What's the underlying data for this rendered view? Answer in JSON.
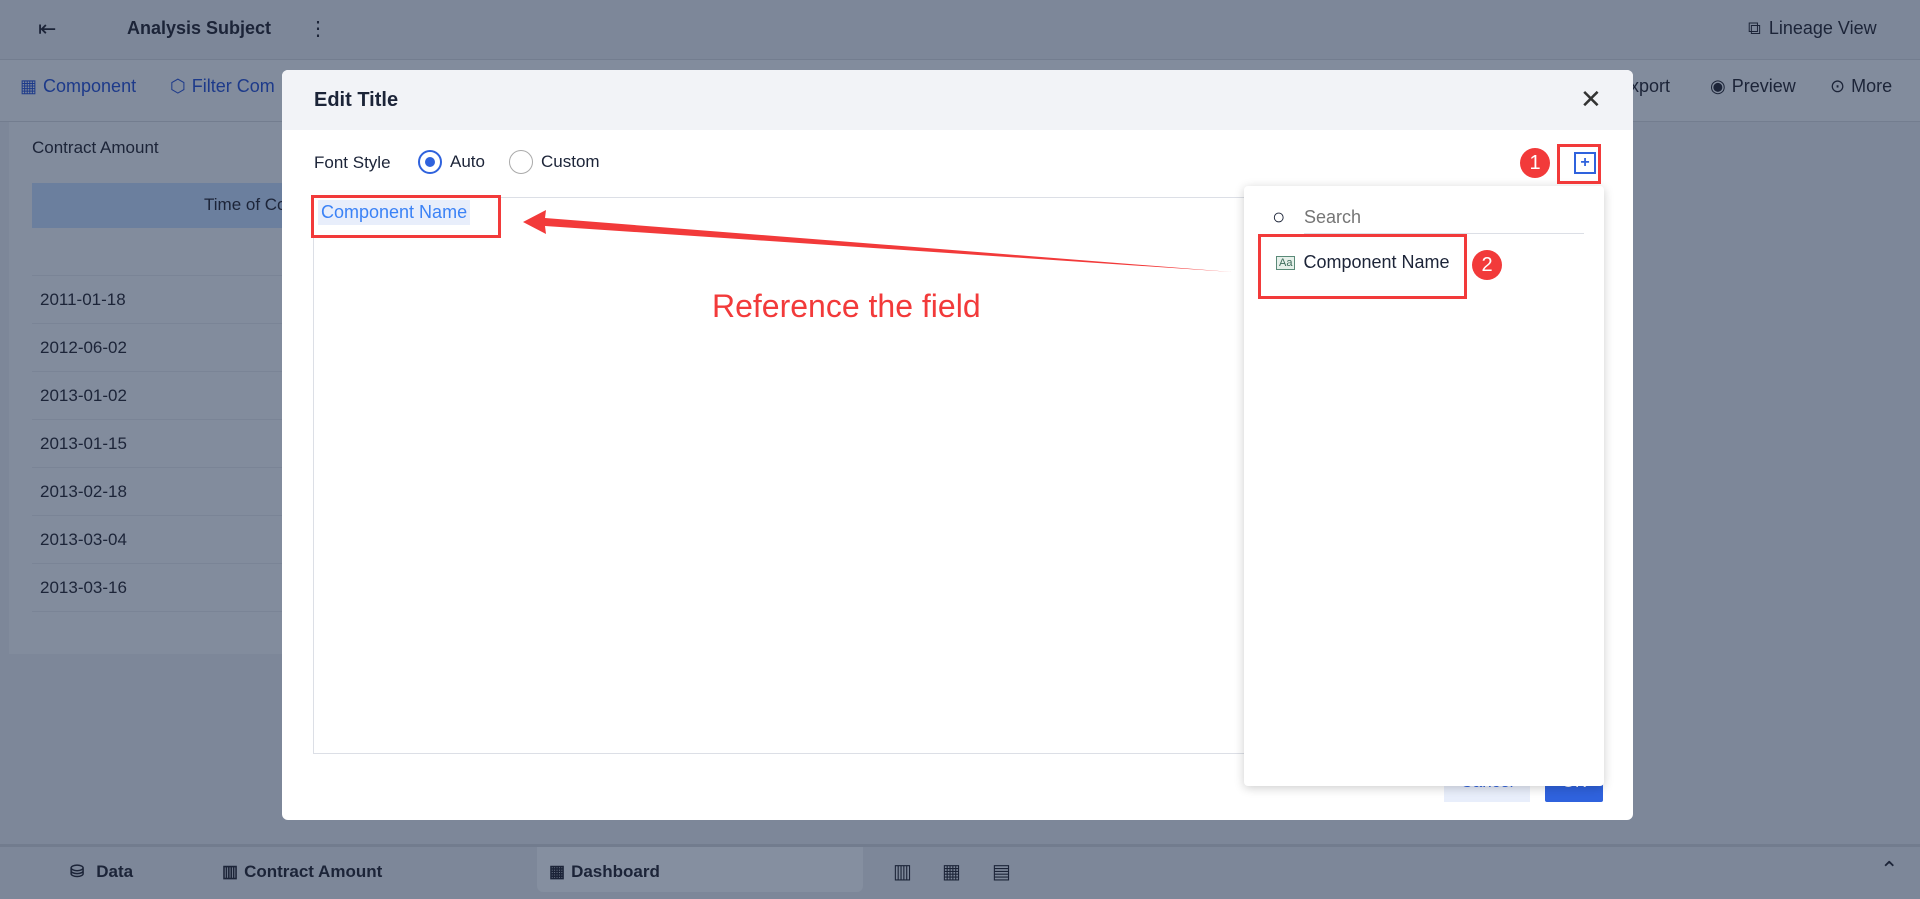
{
  "topbar": {
    "title": "Analysis Subject",
    "lineage": "Lineage View"
  },
  "toolbar": {
    "component": "Component",
    "filter": "Filter Com",
    "export": "xport",
    "preview": "Preview",
    "more": "More"
  },
  "card": {
    "title": "Contract Amount",
    "column_header": "Time of Co",
    "rows": [
      "2011-01-18",
      "2012-06-02",
      "2013-01-02",
      "2013-01-15",
      "2013-02-18",
      "2013-03-04",
      "2013-03-16"
    ]
  },
  "modal": {
    "title": "Edit Title",
    "font_style_label": "Font Style",
    "options": [
      "Auto",
      "Custom"
    ],
    "selected": "Auto",
    "editor_token": "Component Name",
    "cancel": "Cancel",
    "ok": "OK"
  },
  "dropdown": {
    "search_placeholder": "Search",
    "items": [
      "Component Name"
    ]
  },
  "annotations": {
    "label": "Reference the field",
    "step1": "1",
    "step2": "2"
  },
  "bottombar": {
    "data": "Data",
    "contract": "Contract Amount",
    "dashboard": "Dashboard"
  },
  "colors": {
    "accent": "#2f62dd",
    "annotation": "#f23a3a"
  }
}
